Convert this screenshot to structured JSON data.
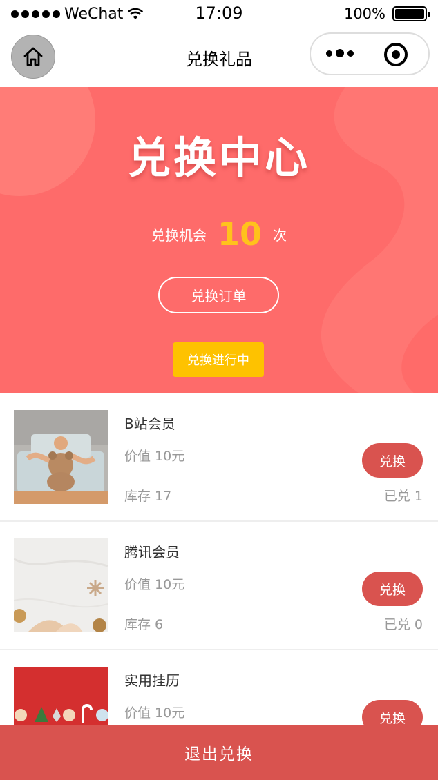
{
  "status_bar": {
    "carrier": "WeChat",
    "time": "17:09",
    "battery": "100%"
  },
  "nav": {
    "title": "兑换礼品"
  },
  "banner": {
    "title": "兑换中心",
    "chance_label": "兑换机会",
    "chance_count": "10",
    "chance_unit": "次",
    "orders_button": "兑换订单",
    "status_badge": "兑换进行中"
  },
  "items": [
    {
      "name": "B站会员",
      "value": "价值 10元",
      "stock": "库存 17",
      "button": "兑换",
      "redeemed": "已兑 1"
    },
    {
      "name": "腾讯会员",
      "value": "价值 10元",
      "stock": "库存 6",
      "button": "兑换",
      "redeemed": "已兑 0"
    },
    {
      "name": "实用挂历",
      "value": "价值 10元",
      "stock": "",
      "button": "兑换",
      "redeemed": ""
    }
  ],
  "footer": {
    "exit_button": "退出兑换"
  },
  "colors": {
    "banner_bg": "#fe6b6a",
    "accent_yellow": "#ffc21c",
    "button_red": "#d9534f"
  }
}
